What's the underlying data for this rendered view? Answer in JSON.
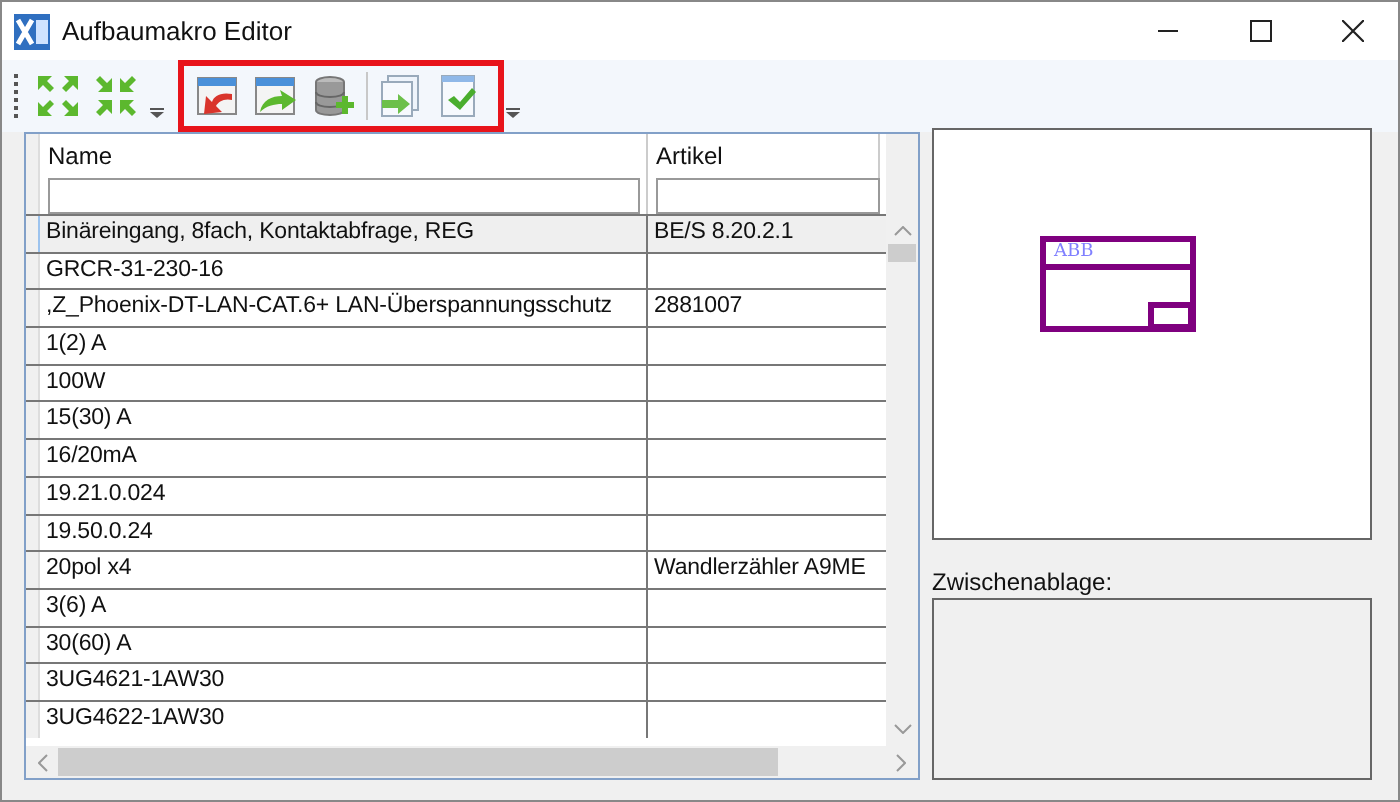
{
  "window": {
    "title": "Aufbaumakro Editor"
  },
  "toolbar": {
    "highlight_frame": true
  },
  "table": {
    "columns": [
      "Name",
      "Artikel"
    ],
    "rows": [
      {
        "name": "Binäreingang, 8fach, Kontaktabfrage, REG",
        "artikel": "BE/S 8.20.2.1",
        "selected": true
      },
      {
        "name": "GRCR-31-230-16",
        "selected": false
      },
      {
        "name": ",Z_Phoenix-DT-LAN-CAT.6+ LAN-Überspannungsschutz",
        "artikel": "2881007",
        "selected": false
      },
      {
        "name": "1(2) A",
        "selected": false
      },
      {
        "name": "100W",
        "selected": false
      },
      {
        "name": "15(30) A",
        "selected": false
      },
      {
        "name": "16/20mA",
        "selected": false
      },
      {
        "name": "19.21.0.024",
        "selected": false
      },
      {
        "name": "19.50.0.24",
        "selected": false
      },
      {
        "name": "20pol x4",
        "artikel": "Wandlerzähler A9ME",
        "selected": false
      },
      {
        "name": "3(6) A",
        "selected": false
      },
      {
        "name": "30(60) A",
        "selected": false
      },
      {
        "name": "3UG4621-1AW30",
        "selected": false
      },
      {
        "name": "3UG4622-1AW30",
        "selected": false
      }
    ]
  },
  "preview": {
    "label": "ABB"
  },
  "clipboard": {
    "label": "Zwischenablage:"
  }
}
